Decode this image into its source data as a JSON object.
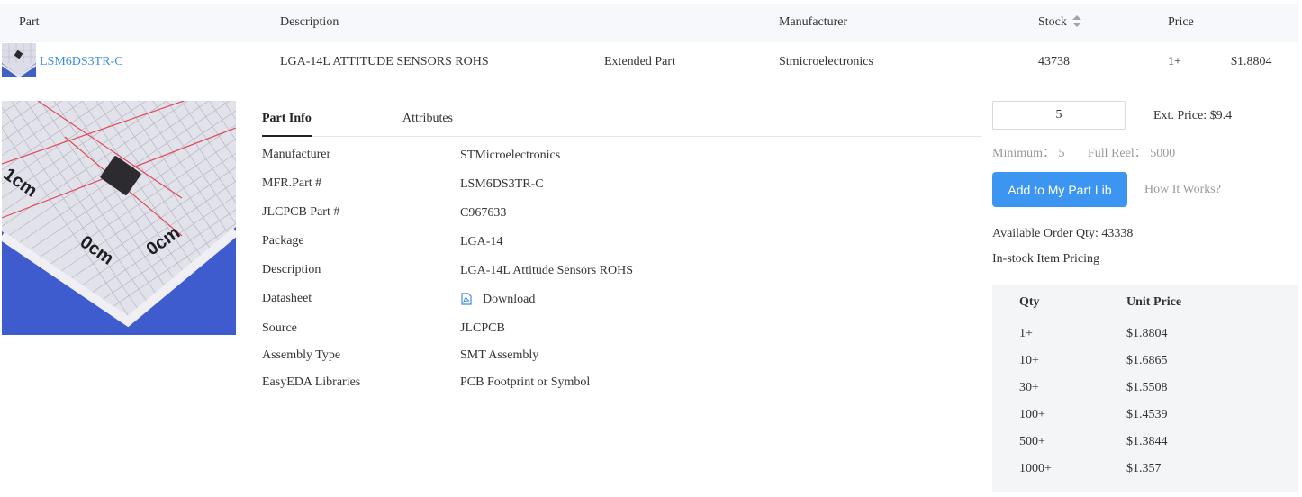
{
  "table": {
    "headers": {
      "part": "Part",
      "description": "Description",
      "manufacturer": "Manufacturer",
      "stock": "Stock",
      "price": "Price"
    },
    "row": {
      "part_number": "LSM6DS3TR-C",
      "description": "LGA-14L ATTITUDE SENSORS ROHS",
      "part_type": "Extended Part",
      "manufacturer": "Stmicroelectronics",
      "stock": "43738",
      "price_qty": "1+",
      "price": "$1.8804"
    }
  },
  "tabs": {
    "part_info": "Part Info",
    "attributes": "Attributes"
  },
  "part_info": {
    "manufacturer_label": "Manufacturer",
    "manufacturer_value": "STMicroelectronics",
    "mfr_part_label": "MFR.Part #",
    "mfr_part_value": "LSM6DS3TR-C",
    "jlcpcb_part_label": "JLCPCB Part #",
    "jlcpcb_part_value": "C967633",
    "package_label": "Package",
    "package_value": "LGA-14",
    "description_label": "Description",
    "description_value": "LGA-14L Attitude Sensors ROHS",
    "datasheet_label": "Datasheet",
    "datasheet_value": "Download",
    "source_label": "Source",
    "source_value": "JLCPCB",
    "assembly_label": "Assembly Type",
    "assembly_value": "SMT Assembly",
    "easyeda_label": "EasyEDA Libraries",
    "easyeda_value": "PCB Footprint or Symbol"
  },
  "order": {
    "quantity": "5",
    "ext_price": "Ext. Price: $9.4",
    "minimum": "Minimum： 5",
    "full_reel": "Full Reel： 5000",
    "add_button": "Add to My Part Lib",
    "how_it_works": "How It Works?",
    "available_qty": "Available Order Qty: 43338",
    "pricing_title": "In-stock Item Pricing"
  },
  "pricing": {
    "qty_header": "Qty",
    "price_header": "Unit Price",
    "tiers": [
      {
        "qty": "1+",
        "price": "$1.8804"
      },
      {
        "qty": "10+",
        "price": "$1.6865"
      },
      {
        "qty": "30+",
        "price": "$1.5508"
      },
      {
        "qty": "100+",
        "price": "$1.4539"
      },
      {
        "qty": "500+",
        "price": "$1.3844"
      },
      {
        "qty": "1000+",
        "price": "$1.357"
      }
    ]
  },
  "icons": {
    "sort": "sort-icon",
    "pdf": "pdf-icon"
  },
  "colors": {
    "link": "#3c8ce7",
    "button": "#3c95f0",
    "header_bg": "#f7f8fb",
    "panel_bg": "#f4f5f7"
  }
}
